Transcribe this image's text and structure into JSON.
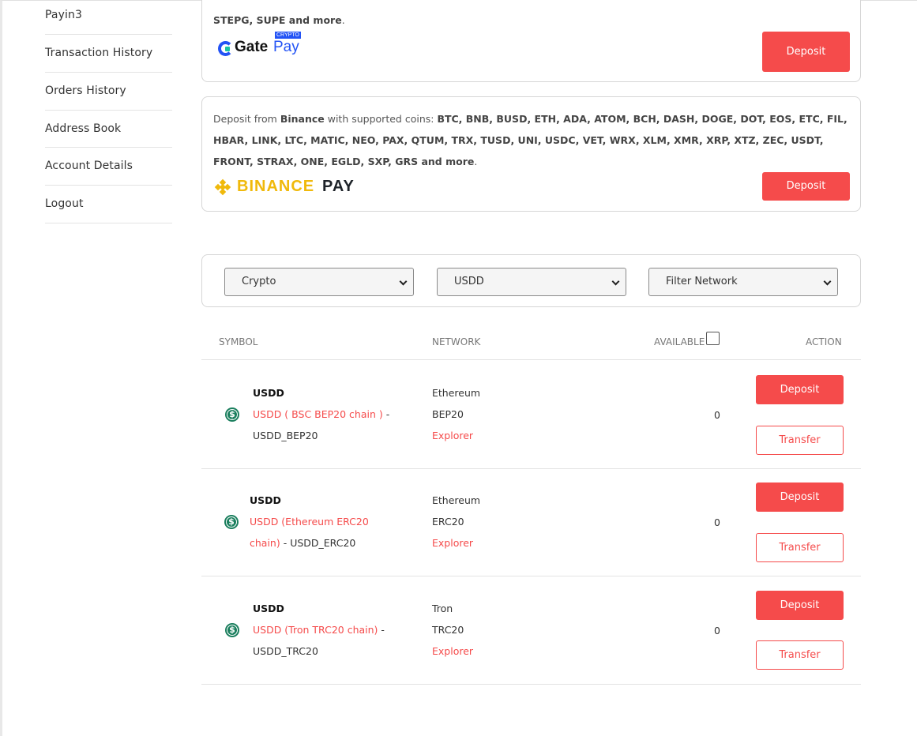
{
  "sidebar": {
    "items": [
      {
        "label": "Payin3"
      },
      {
        "label": "Transaction History"
      },
      {
        "label": "Orders History"
      },
      {
        "label": "Address Book"
      },
      {
        "label": "Account Details"
      },
      {
        "label": "Logout"
      }
    ]
  },
  "gate_card": {
    "coins_tail_bold": "STEPG, SUPE and more",
    "period": ".",
    "logo": {
      "word": "Gate",
      "pay": "Pay",
      "badge": "CRYPTO"
    },
    "deposit_label": "Deposit"
  },
  "binance_card": {
    "prefix": "Deposit from ",
    "provider": "Binance",
    "middle": " with supported coins: ",
    "coins": "BTC, BNB, BUSD, ETH, ADA, ATOM, BCH, DASH, DOGE, DOT, EOS, ETC, FIL, HBAR, LINK, LTC, MATIC, NEO, PAX, QTUM, TRX, TUSD, UNI, USDC, VET, WRX, XLM, XMR, XRP, XTZ, ZEC, USDT, FRONT, STRAX, ONE, EGLD, SXP, GRS and more",
    "period": ".",
    "logo": {
      "word": "BINANCE",
      "pay": "PAY"
    },
    "deposit_label": "Deposit"
  },
  "filters": {
    "type_select": "Crypto",
    "coin_select": "USDD",
    "network_select": "Filter Network"
  },
  "table": {
    "headers": {
      "symbol": "SYMBOL",
      "network": "NETWORK",
      "available": "AVAILABLE",
      "action": "ACTION"
    },
    "rows": [
      {
        "symbol": "USDD",
        "link": "USDD ( BSC BEP20 chain )",
        "dash": " - ",
        "code": "USDD_BEP20",
        "chain": "Ethereum",
        "network": "BEP20",
        "explorer": "Explorer",
        "available": "0",
        "deposit": "Deposit",
        "transfer": "Transfer"
      },
      {
        "symbol": "USDD",
        "link": "USDD (Ethereum ERC20 chain)",
        "dash": " - ",
        "code": "USDD_ERC20",
        "chain": "Ethereum",
        "network": "ERC20",
        "explorer": "Explorer",
        "available": "0",
        "deposit": "Deposit",
        "transfer": "Transfer"
      },
      {
        "symbol": "USDD",
        "link": "USDD (Tron TRC20 chain)",
        "dash": " - ",
        "code": "USDD_TRC20",
        "chain": "Tron",
        "network": "TRC20",
        "explorer": "Explorer",
        "available": "0",
        "deposit": "Deposit",
        "transfer": "Transfer"
      }
    ]
  },
  "colors": {
    "accent": "#f54b4b",
    "coin_icon": "#1b7f5e",
    "binance": "#f0b90b",
    "gate": "#2353f5"
  },
  "icons": {
    "coin": "usdd-dollar-coin-icon",
    "select_arrow": "chevron-down-icon"
  }
}
